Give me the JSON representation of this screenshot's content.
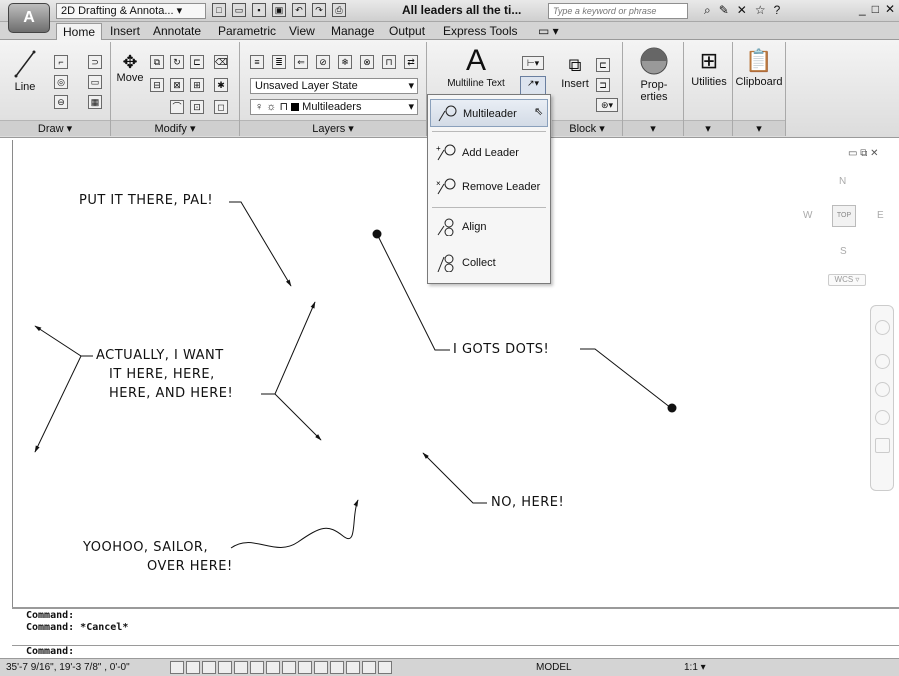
{
  "app": {
    "logo": "A",
    "workspace": "2D Drafting & Annota...",
    "doc_title": "All leaders all the ti...",
    "search_placeholder": "Type a keyword or phrase"
  },
  "tabs": [
    "Home",
    "Insert",
    "Annotate",
    "Parametric",
    "View",
    "Manage",
    "Output",
    "Express Tools"
  ],
  "ribbon": {
    "line": "Line",
    "move": "Move",
    "layer_state": "Unsaved Layer State",
    "layer_name": "Multileaders",
    "mtext": "Multiline Text",
    "insert": "Insert",
    "properties": "Prop-\nerties",
    "utilities": "Utilities",
    "clipboard": "Clipboard",
    "panels": [
      "Draw ▾",
      "Modify ▾",
      "Layers ▾",
      "Block ▾"
    ]
  },
  "dropdown": {
    "items": [
      "Multileader",
      "Add Leader",
      "Remove Leader",
      "Align",
      "Collect"
    ]
  },
  "drawing": {
    "t1": "PUT IT THERE, PAL!",
    "t2a": "ACTUALLY, I WANT",
    "t2b": "IT HERE, HERE,",
    "t2c": "HERE, AND HERE!",
    "t3": "I GOTS DOTS!",
    "t4": "NO, HERE!",
    "t5a": "YOOHOO, SAILOR,",
    "t5b": "OVER HERE!"
  },
  "viewcube": {
    "n": "N",
    "s": "S",
    "w": "W",
    "e": "E",
    "top": "TOP",
    "wcs": "WCS ▿"
  },
  "command": {
    "line1": "Command:",
    "line2": "Command: *Cancel*",
    "prompt": "Command:"
  },
  "status": {
    "coords": "35'-7 9/16\", 19'-3 7/8\" , 0'-0\"",
    "model": "MODEL",
    "scale": "1:1 ▾"
  }
}
